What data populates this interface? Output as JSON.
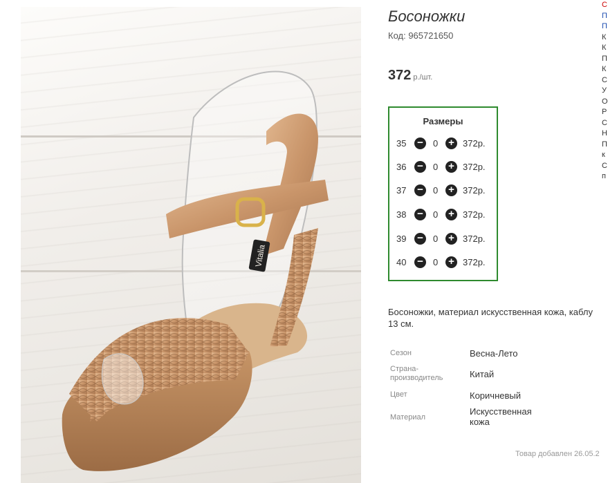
{
  "product": {
    "title": "Босоножки",
    "code_label": "Код: 965721650",
    "price": "372",
    "price_unit": "р./шт.",
    "image_brand_text": "Vitalia"
  },
  "sizes": {
    "title": "Размеры",
    "minus_symbol": "−",
    "plus_symbol": "+",
    "rows": [
      {
        "size": "35",
        "qty": "0",
        "price": "372р."
      },
      {
        "size": "36",
        "qty": "0",
        "price": "372р."
      },
      {
        "size": "37",
        "qty": "0",
        "price": "372р."
      },
      {
        "size": "38",
        "qty": "0",
        "price": "372р."
      },
      {
        "size": "39",
        "qty": "0",
        "price": "372р."
      },
      {
        "size": "40",
        "qty": "0",
        "price": "372р."
      }
    ]
  },
  "description": {
    "line1": "Босоножки, материал искусственная кожа, каблу",
    "line2": "13 см."
  },
  "specs": [
    {
      "label": "Сезон",
      "value": "Весна-Лето"
    },
    {
      "label": "Страна-производитель",
      "label_lines": [
        "Страна-",
        "производитель"
      ],
      "value": "Китай"
    },
    {
      "label": "Цвет",
      "value": "Коричневый"
    },
    {
      "label": "Материал",
      "value": "Искусственная кожа",
      "value_lines": [
        "Искусственная",
        "кожа"
      ]
    }
  ],
  "added_text": "Товар добавлен 26.05.2",
  "side_column": [
    "С",
    "П",
    "П",
    "К",
    "К",
    "П",
    "К",
    "С",
    "У",
    "О",
    "Р",
    "С",
    "Н",
    "П",
    "к",
    "С",
    "п"
  ],
  "colors": {
    "accent_border": "#2e8a2e",
    "side_red": "#cc0000",
    "side_blue": "#1a4bb0"
  }
}
